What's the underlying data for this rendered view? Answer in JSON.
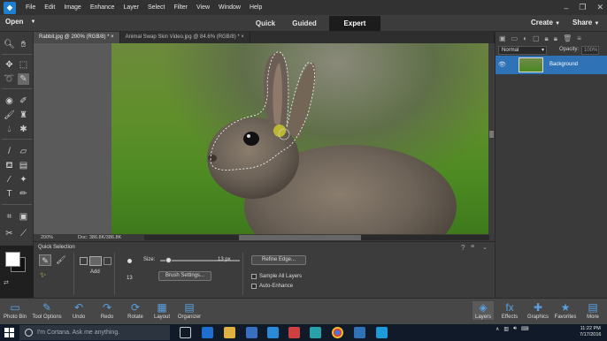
{
  "menubar": {
    "items": [
      "File",
      "Edit",
      "Image",
      "Enhance",
      "Layer",
      "Select",
      "Filter",
      "View",
      "Window",
      "Help"
    ]
  },
  "modebar": {
    "open_label": "Open",
    "tabs": [
      "Quick",
      "Guided",
      "Expert"
    ],
    "active_tab": "Expert",
    "create_label": "Create",
    "share_label": "Share"
  },
  "documents": {
    "tabs": [
      "Rabbit.jpg @ 200% (RGB/8) *",
      "Animal Swap Skin Video.jpg @ 84.6% (RGB/8) *"
    ],
    "active": 0
  },
  "status": {
    "zoom": "200%",
    "doc_info": "Doc: 386.8K/386.8K"
  },
  "tool_options": {
    "title": "Quick Selection",
    "add_label": "Add",
    "size_label": "Size:",
    "size_value": "13 px",
    "size_fraction": 0.1,
    "brush_preview_size": "13",
    "brush_settings_label": "Brush Settings...",
    "refine_edge_label": "Refine Edge...",
    "sample_all_layers_label": "Sample All Layers",
    "auto_enhance_label": "Auto-Enhance"
  },
  "layers_panel": {
    "blend_mode": "Normal",
    "opacity_label": "Opacity:",
    "opacity_value": "100%",
    "layer_name": "Background"
  },
  "bin": {
    "left": [
      "Photo Bin",
      "Tool Options",
      "Undo",
      "Redo",
      "Rotate",
      "Layout",
      "Organizer"
    ],
    "right": [
      "Layers",
      "Effects",
      "Graphics",
      "Favorites",
      "More"
    ]
  },
  "taskbar": {
    "search_placeholder": "I'm Cortana. Ask me anything.",
    "time": "11:22 PM",
    "date": "7/17/2016"
  },
  "colors": {
    "accent": "#2f73b6",
    "selection_marker": "#c8c82a"
  }
}
